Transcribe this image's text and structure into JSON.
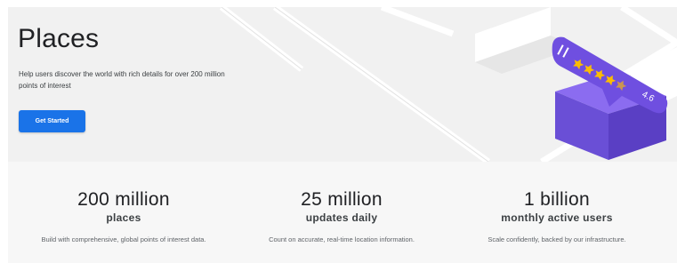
{
  "hero": {
    "title": "Places",
    "description": "Help users discover the world with rich details for over 200 million points of interest",
    "cta_label": "Get Started",
    "rating_value": "4.6",
    "rating_stars": 4.5
  },
  "stats": [
    {
      "value": "200 million",
      "label": "places",
      "description": "Build with comprehensive, global points of interest data."
    },
    {
      "value": "25 million",
      "label": "updates daily",
      "description": "Count on accurate, real-time location information."
    },
    {
      "value": "1 billion",
      "label": "monthly active users",
      "description": "Scale confidently, backed by our infrastructure."
    }
  ],
  "colors": {
    "accent": "#1a73e8",
    "marker": "#6f4fe0",
    "star": "#fbbc04"
  }
}
